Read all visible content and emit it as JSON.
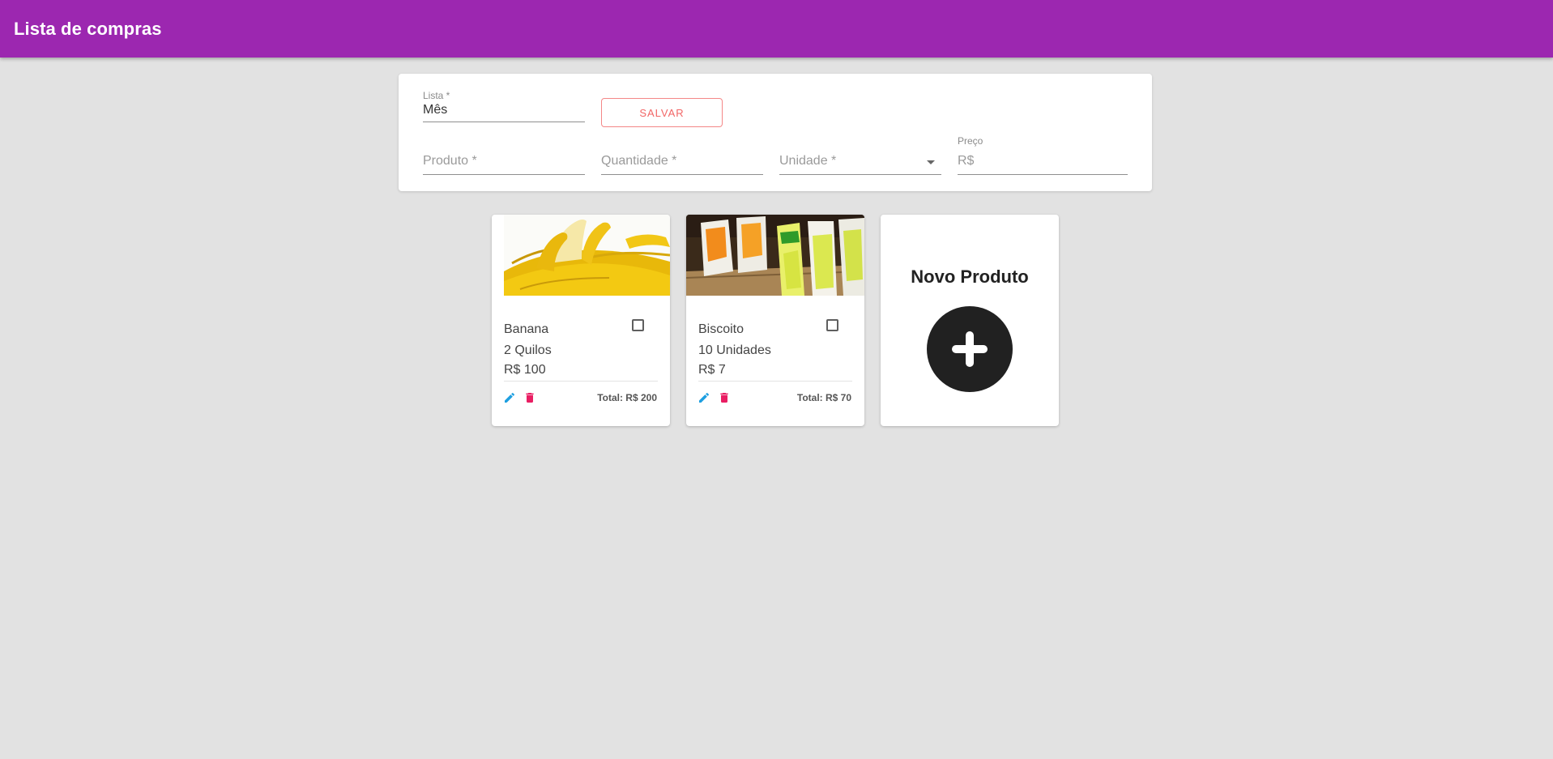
{
  "appbar": {
    "title": "Lista de compras"
  },
  "colors": {
    "brand": "#9c27b0",
    "edit": "#1e9fe0",
    "delete": "#e91e63",
    "fab": "#212121"
  },
  "form": {
    "list": {
      "label": "Lista *",
      "value": "Mês"
    },
    "save_label": "SALVAR",
    "product": {
      "placeholder": "Produto *"
    },
    "quantity": {
      "placeholder": "Quantidade *"
    },
    "unit": {
      "placeholder": "Unidade *"
    },
    "price": {
      "label": "Preço",
      "placeholder": "R$"
    }
  },
  "products": [
    {
      "name": "Banana",
      "quantity": "2 Quilos",
      "price": "R$ 100",
      "total": "Total: R$ 200",
      "image": "banana-image",
      "checked": false
    },
    {
      "name": "Biscoito",
      "quantity": "10 Unidades",
      "price": "R$ 7",
      "total": "Total: R$ 70",
      "image": "biscuit-image",
      "checked": false
    }
  ],
  "new_product": {
    "title": "Novo Produto",
    "icon": "plus-icon"
  }
}
